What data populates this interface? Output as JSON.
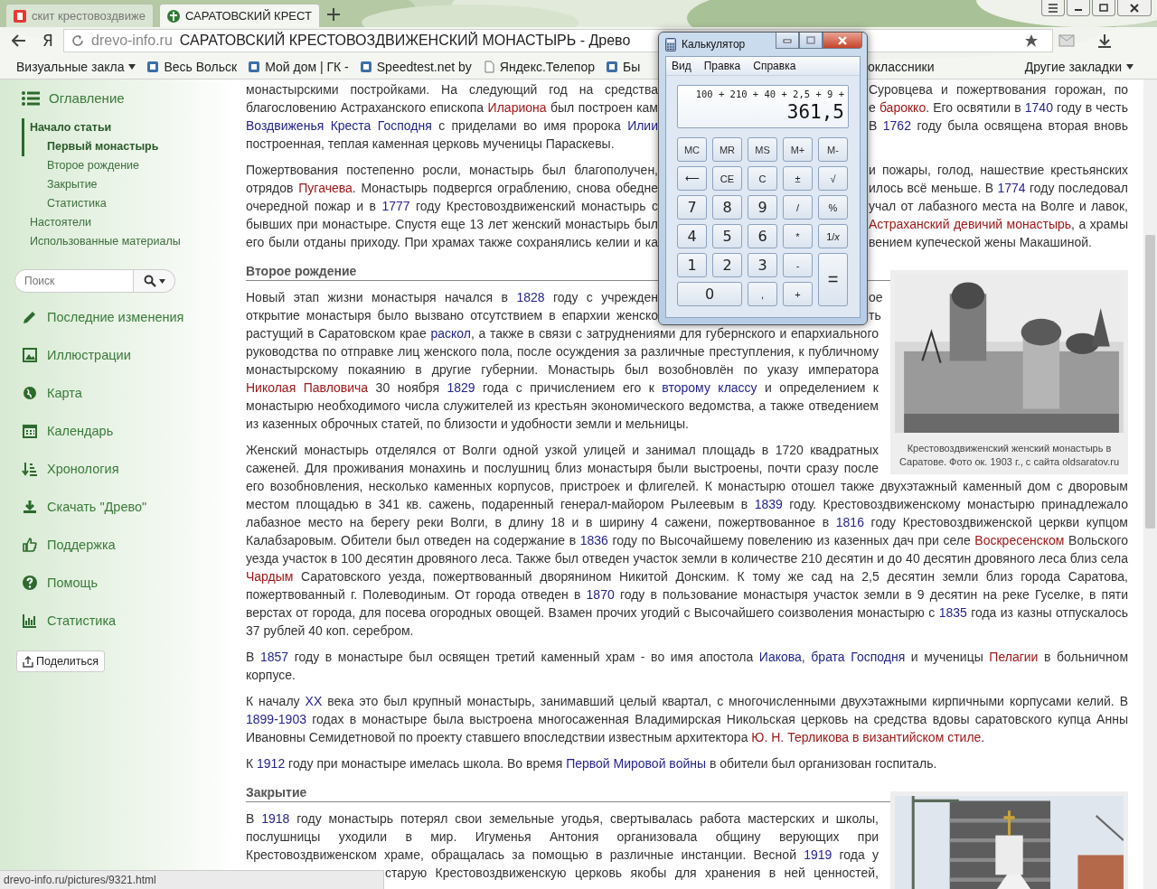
{
  "browser": {
    "tabs": [
      {
        "title": "скит крестовоздвиже",
        "selected": false
      },
      {
        "title": "САРАТОВСКИЙ КРЕСТ",
        "selected": true
      }
    ],
    "yandex_button": "Я",
    "address": {
      "domain": "drevo-info.ru",
      "title": "САРАТОВСКИЙ КРЕСТОВОЗДВИЖЕНСКИЙ МОНАСТЫРЬ - Древо"
    },
    "bookmarks_left": [
      {
        "label": "Визуальные закла",
        "kind": "folder"
      },
      {
        "label": "Весь Вольск",
        "kind": "site"
      },
      {
        "label": "Мой дом | ГК -",
        "kind": "site"
      },
      {
        "label": "Speedtest.net by",
        "kind": "site"
      },
      {
        "label": "Яндекс.Телепор",
        "kind": "page"
      },
      {
        "label": "Бы",
        "kind": "site"
      }
    ],
    "bookmarks_right": [
      {
        "label": "оклассники",
        "kind": "plain"
      },
      {
        "label": "Другие закладки",
        "kind": "folder"
      }
    ]
  },
  "sidebar": {
    "toc": {
      "title": "Оглавление",
      "items": [
        {
          "label": "Начало статьи",
          "selected": true,
          "children": [
            {
              "label": "Первый монастырь",
              "selected": true
            },
            {
              "label": "Второе рождение",
              "selected": false
            },
            {
              "label": "Закрытие",
              "selected": false
            },
            {
              "label": "Статистика",
              "selected": false
            }
          ]
        },
        {
          "label": "Настоятели",
          "selected": false
        },
        {
          "label": "Использованные материалы",
          "selected": false
        }
      ]
    },
    "search": {
      "placeholder": "Поиск"
    },
    "nav": [
      {
        "label": "Последние изменения",
        "kind": "pencil"
      },
      {
        "label": "Иллюстрации",
        "kind": "picture"
      },
      {
        "label": "Карта",
        "kind": "globe"
      },
      {
        "label": "Календарь",
        "kind": "calendar"
      },
      {
        "label": "Хронология",
        "kind": "sort"
      },
      {
        "label": "Скачать \"Древо\"",
        "kind": "download"
      },
      {
        "label": "Поддержка",
        "kind": "thumb"
      },
      {
        "label": "Помощь",
        "kind": "help"
      },
      {
        "label": "Статистика",
        "kind": "chart"
      }
    ],
    "share_button": "Поделиться"
  },
  "article": {
    "blocks": [
      {
        "kind": "lines",
        "lines": [
          {
            "kind": "under_window",
            "left": [
              {
                "text": "монастырскими постройками. На следующий год на средства"
              }
            ],
            "right": [
              {
                "text": "Суровцева и пожертвования горожан, по"
              }
            ]
          },
          {
            "kind": "under_window",
            "left": [
              {
                "text": "благословению Астраханского епископа "
              },
              {
                "text": "Илариона",
                "kind": "red_link"
              },
              {
                "text": " был построен кам"
              }
            ],
            "right": [
              {
                "text": "е "
              },
              {
                "text": "барокко",
                "kind": "red_link"
              },
              {
                "text": ". Его освятили в "
              },
              {
                "text": "1740",
                "kind": "link"
              },
              {
                "text": " году в честь"
              }
            ]
          },
          {
            "kind": "under_window",
            "left": [
              {
                "text": "Воздвиженья Креста Господня",
                "kind": "link"
              },
              {
                "text": " с приделами во имя пророка "
              },
              {
                "text": "Илии",
                "kind": "link"
              }
            ],
            "right": [
              {
                "text": "В "
              },
              {
                "text": "1762",
                "kind": "link"
              },
              {
                "text": " году была освящена вторая вновь"
              }
            ]
          },
          {
            "kind": "last",
            "left": [
              {
                "text": "построенная, теплая каменная церковь мученицы Параскевы."
              }
            ]
          }
        ]
      },
      {
        "kind": "lines",
        "lines": [
          {
            "kind": "under_window",
            "left": [
              {
                "text": "Пожертвования постепенно росли, монастырь был благополучен,"
              }
            ],
            "right": [
              {
                "text": "и пожары, голод, нашествие крестьянских"
              }
            ]
          },
          {
            "kind": "under_window",
            "left": [
              {
                "text": "отрядов "
              },
              {
                "text": "Пугачева",
                "kind": "red_link"
              },
              {
                "text": ". Монастырь подвергся ограблению, снова обедне"
              }
            ],
            "right": [
              {
                "text": "илось всё меньше. В "
              },
              {
                "text": "1774",
                "kind": "link"
              },
              {
                "text": " году последовал"
              }
            ]
          },
          {
            "kind": "under_window",
            "left": [
              {
                "text": "очередной пожар и в "
              },
              {
                "text": "1777",
                "kind": "link"
              },
              {
                "text": " году Крестовоздвиженский монастырь с"
              }
            ],
            "right": [
              {
                "text": "учал от лабазного места на Волге и лавок,"
              }
            ]
          },
          {
            "kind": "under_window",
            "left": [
              {
                "text": "бывших при монастыре. Спустя еще 13 лет женский монастырь был"
              }
            ],
            "right": [
              {
                "text": "Астраханский девичий монастырь",
                "kind": "red_link"
              },
              {
                "text": ", а храмы"
              }
            ]
          },
          {
            "kind": "under_window_end",
            "left": [
              {
                "text": "его были отданы приходу. При храмах также сохранялись келии и ка"
              }
            ],
            "right": [
              {
                "text": "вением купеческой жены Макашиной."
              }
            ]
          }
        ]
      },
      {
        "kind": "heading",
        "text": "Второе рождение"
      },
      {
        "kind": "lines",
        "lines": [
          {
            "kind": "under_window",
            "left": [
              {
                "text": "Новый этап жизни монастыря начался в "
              },
              {
                "text": "1828",
                "kind": "link"
              },
              {
                "text": " году с учрежден"
              }
            ],
            "right": [
              {
                "text": "ое"
              }
            ]
          },
          {
            "kind": "under_window",
            "left": [
              {
                "text": "открытие монастыря было вызвано отсутствием в епархии женско"
              }
            ],
            "right": [
              {
                "text": "ть"
              }
            ]
          }
        ],
        "rest": [
          {
            "text": "растущий в Саратовском крае "
          },
          {
            "text": "раскол",
            "kind": "link"
          },
          {
            "text": ", а также в связи с затруднениями для губернского и епархиального руководства по отправке лиц женского пола, после осуждения за различные преступления, к публичному монастырскому покаянию в другие губернии. Монастырь был возобновлён по указу императора "
          },
          {
            "text": "Николая",
            "kind": "red_link"
          },
          {
            "text": " Павловича",
            "kind": "red_link"
          },
          {
            "text": " 30 ноября "
          },
          {
            "text": "1829",
            "kind": "link"
          },
          {
            "text": " года с причислением его к "
          },
          {
            "text": "второму классу",
            "kind": "link"
          },
          {
            "text": " и определением к монастырю необходимого числа служителей из крестьян экономического ведомства, а также отведением из казенных оброчных статей, по близости и удобности земли и мельницы."
          }
        ]
      },
      {
        "kind": "figure",
        "caption": "Крестовоздвиженский женский монастырь в Саратове. Фото ок. 1903 г., с сайта oldsaratov.ru"
      },
      {
        "kind": "lines",
        "lines": [
          {
            "kind": "full",
            "left": [
              {
                "text": "Женский монастырь отделялся от Волги одной узкой улицей и занимал площадь в 1720 квадратных"
              }
            ]
          },
          {
            "kind": "full",
            "left": [
              {
                "text": "саженей. Для проживания монахинь и послушниц близ монастыря были выстроены, почти сразу после"
              }
            ]
          }
        ],
        "rest": [
          {
            "text": "его возобновления, несколько каменных корпусов, пристроек и флигелей. К монастырю отошел также двухэтажный каменный дом с дворовым местом площадью в 341 кв. сажень, подаренный генерал-майором Рылеевым в "
          },
          {
            "text": "1839",
            "kind": "link"
          },
          {
            "text": " году. Крестовоздвиженскому монастырю принадлежало лабазное место на берегу реки Волги, в длину 18 и в ширину 4 сажени, пожертвованное в "
          },
          {
            "text": "1816",
            "kind": "link"
          },
          {
            "text": " году Крестовоздвиженской церкви купцом Калабзаровым. Обители был отведен на содержание в "
          },
          {
            "text": "1836",
            "kind": "link"
          },
          {
            "text": " году по Высочайшему повелению из казенных дач при селе "
          },
          {
            "text": "Воскресенском",
            "kind": "red_link"
          },
          {
            "text": " Вольского уезда участок в 100 десятин дровяного леса. Также был отведен участок земли в количестве 210 десятин и до 40 десятин дровяного леса близ села "
          },
          {
            "text": "Чардым",
            "kind": "red_link"
          },
          {
            "text": " Саратовского уезда, пожертвованный дворянином Никитой Донским. К тому же сад на 2,5 десятин земли близ города Саратова, пожертвованный г. Полеводиным. От города отведен в "
          },
          {
            "text": "1870",
            "kind": "link"
          },
          {
            "text": " году в пользование монастыря участок земли в 9 десятин на реке Гуселке, в пяти верстах от города, для посева огородных овощей. Взамен прочих угодий с Высочайшего соизволения монастырю с "
          },
          {
            "text": "1835",
            "kind": "link"
          },
          {
            "text": " года из казны отпускалось 37 рублей 40 коп. серебром."
          }
        ]
      },
      {
        "kind": "paragraph",
        "parts": [
          {
            "text": "В "
          },
          {
            "text": "1857",
            "kind": "link"
          },
          {
            "text": " году в монастыре был освящен третий каменный храм - во имя апостола "
          },
          {
            "text": "Иакова",
            "kind": "link"
          },
          {
            "text": ", "
          },
          {
            "text": "брата Господня",
            "kind": "link"
          },
          {
            "text": " и мученицы "
          },
          {
            "text": "Пелагии",
            "kind": "red_link"
          },
          {
            "text": " в больничном корпусе."
          }
        ]
      },
      {
        "kind": "paragraph",
        "parts": [
          {
            "text": "К началу "
          },
          {
            "text": "XX",
            "kind": "link"
          },
          {
            "text": " века это был крупный монастырь, занимавший целый квартал, с многочисленными двухэтажными кирпичными корпусами келий. В "
          },
          {
            "text": "1899-1903",
            "kind": "link"
          },
          {
            "text": " годах в монастыре была выстроена многосаженная Владимирская Никольская церковь на средства вдовы саратовского купца Анны Ивановны Семидетновой по проекту ставшего впоследствии известным архитектора "
          },
          {
            "text": "Ю. Н. Терликова",
            "kind": "red_link"
          },
          {
            "text": " в византийском стиле",
            "kind": "red_link"
          },
          {
            "text": "."
          }
        ]
      },
      {
        "kind": "paragraph",
        "parts": [
          {
            "text": "К "
          },
          {
            "text": "1912",
            "kind": "link"
          },
          {
            "text": " году при монастыре имелась школа. Во время "
          },
          {
            "text": "Первой Мировой войны",
            "kind": "link"
          },
          {
            "text": " в обители был организован госпиталь."
          }
        ]
      },
      {
        "kind": "heading",
        "text": "Закрытие"
      },
      {
        "kind": "lines",
        "lines": [
          {
            "kind": "full",
            "left": [
              {
                "text": "В "
              },
              {
                "text": "1918",
                "kind": "link"
              },
              {
                "text": " году монастырь потерял свои земельные угодья, свертывалась работа мастерских и школы,"
              }
            ]
          },
          {
            "kind": "full",
            "left": [
              {
                "text": "послушницы уходили в мир. Игуменья Антония организовала общину верующих при"
              }
            ]
          },
          {
            "kind": "full",
            "left": [
              {
                "text": "Крестовоздвиженском храме, обращалась за помощью в различные инстанции. Весной "
              },
              {
                "text": "1919",
                "kind": "link"
              },
              {
                "text": " года у"
              }
            ]
          },
          {
            "kind": "under_status",
            "right": [
              {
                "text": "старую Крестовоздвиженскую церковь якобы для хранения в ней ценностей,"
              }
            ]
          }
        ]
      },
      {
        "kind": "figure"
      }
    ]
  },
  "status_bar": {
    "url": "drevo-info.ru/pictures/9321.html"
  },
  "calculator": {
    "title": "Калькулятор",
    "menu": [
      "Вид",
      "Правка",
      "Справка"
    ],
    "expression": "100 + 210 + 40 + 2,5 + 9 +",
    "value": "361,5",
    "buttons": [
      {
        "label": "MC",
        "kind": "memory"
      },
      {
        "label": "MR",
        "kind": "memory"
      },
      {
        "label": "MS",
        "kind": "memory"
      },
      {
        "label": "M+",
        "kind": "memory"
      },
      {
        "label": "M-",
        "kind": "memory"
      },
      {
        "label": "⟵",
        "kind": "function"
      },
      {
        "label": "CE",
        "kind": "function"
      },
      {
        "label": "C",
        "kind": "function"
      },
      {
        "label": "±",
        "kind": "function"
      },
      {
        "label": "√",
        "kind": "function"
      },
      {
        "label": "7",
        "kind": "digit"
      },
      {
        "label": "8",
        "kind": "digit"
      },
      {
        "label": "9",
        "kind": "digit"
      },
      {
        "label": "/",
        "kind": "function"
      },
      {
        "label": "%",
        "kind": "function"
      },
      {
        "label": "4",
        "kind": "digit"
      },
      {
        "label": "5",
        "kind": "digit"
      },
      {
        "label": "6",
        "kind": "digit"
      },
      {
        "label": "*",
        "kind": "function"
      },
      {
        "label": "1/*x*",
        "kind": "function"
      },
      {
        "label": "1",
        "kind": "digit"
      },
      {
        "label": "2",
        "kind": "digit"
      },
      {
        "label": "3",
        "kind": "digit"
      },
      {
        "label": "-",
        "kind": "function"
      },
      {
        "label": "=",
        "kind": "equals"
      },
      {
        "label": "0",
        "kind": "digit_wide"
      },
      {
        "label": ",",
        "kind": "function"
      },
      {
        "label": "+",
        "kind": "function"
      }
    ]
  }
}
